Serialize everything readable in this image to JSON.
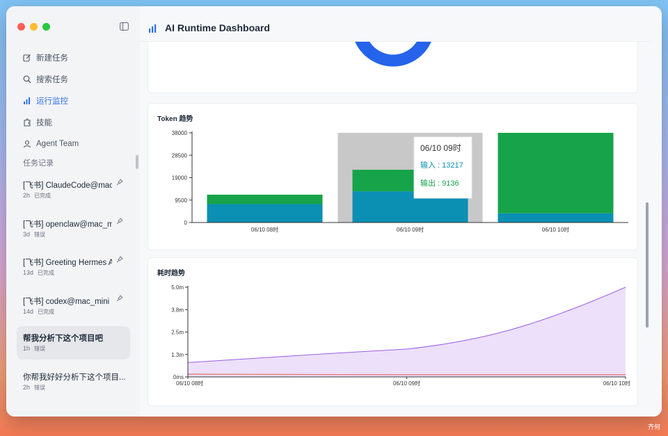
{
  "app": {
    "title": "AI Runtime Dashboard"
  },
  "sidebar": {
    "nav": [
      {
        "label": "新建任务",
        "icon": "edit-icon"
      },
      {
        "label": "搜索任务",
        "icon": "search-icon"
      },
      {
        "label": "运行监控",
        "icon": "bar-chart-icon",
        "active": true
      },
      {
        "label": "技能",
        "icon": "puzzle-icon"
      },
      {
        "label": "Agent Team",
        "icon": "team-icon"
      }
    ],
    "section_label": "任务记录",
    "records": [
      {
        "title": "[飞书] ClaudeCode@mac_mini",
        "age": "2h",
        "status": "已完成",
        "pinned": true
      },
      {
        "title": "[飞书] openclaw@mac_mini",
        "age": "3d",
        "status": "错误",
        "pinned": true
      },
      {
        "title": "[飞书] Greeting Hermes Agent",
        "age": "13d",
        "status": "已完成",
        "pinned": true
      },
      {
        "title": "[飞书] codex@mac_mini",
        "age": "14d",
        "status": "已完成",
        "pinned": true
      },
      {
        "title": "帮我分析下这个项目吧",
        "age": "1h",
        "status": "错误",
        "pinned": false,
        "active": true
      },
      {
        "title": "你帮我好好分析下这个项目...",
        "age": "2h",
        "status": "错误",
        "pinned": false
      }
    ]
  },
  "colors": {
    "accent": "#2f6fe8",
    "input": "#0b8fb3",
    "output": "#16a34a",
    "duration": "#9b5de5"
  },
  "chart_data": [
    {
      "type": "bar",
      "title": "Token 趋势",
      "categories": [
        "06/10 08时",
        "06/10 09时",
        "06/10 10时"
      ],
      "series": [
        {
          "name": "输入",
          "values": [
            7800,
            13217,
            3900
          ]
        },
        {
          "name": "输出",
          "values": [
            4000,
            9136,
            34100
          ]
        }
      ],
      "ylim": [
        0,
        38000
      ],
      "yticks": [
        "0",
        "9500",
        "19000",
        "28500",
        "38000"
      ],
      "tooltip": {
        "title": "06/10 09时",
        "input_label": "输入 : 13217",
        "output_label": "输出 : 9136"
      },
      "stacked": true
    },
    {
      "type": "area",
      "title": "耗时趋势",
      "x": [
        "06/10 08时",
        "06/10 09时",
        "06/10 10时"
      ],
      "yticks": [
        "0ms",
        "1.3m",
        "2.5m",
        "3.8m",
        "5.0m"
      ],
      "ylim": [
        0,
        5.0
      ],
      "series": [
        {
          "values": [
            0.8,
            1.55,
            5.0
          ]
        },
        {
          "values": [
            0.15,
            0.12,
            0.12
          ]
        }
      ]
    }
  ],
  "watermark": "齐何"
}
